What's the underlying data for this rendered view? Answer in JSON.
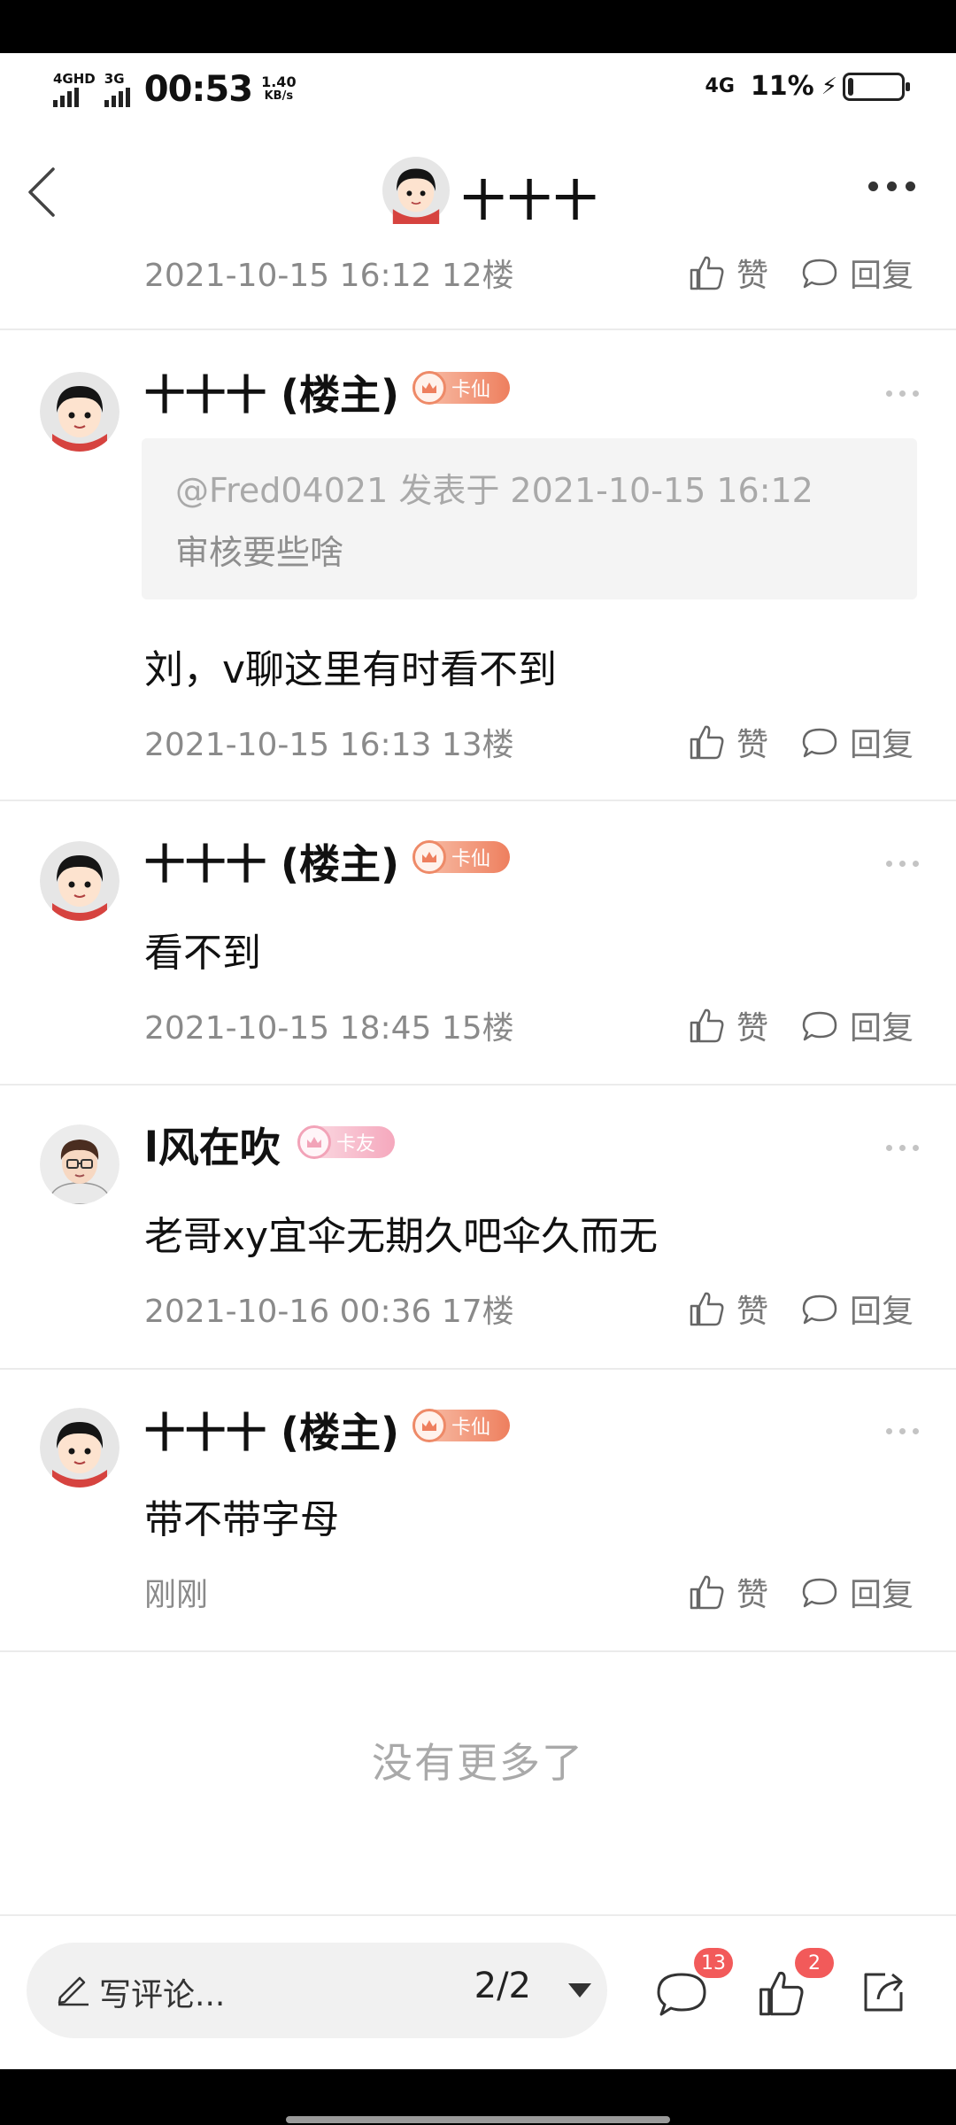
{
  "status": {
    "sig1_label": "4GHD",
    "sig2_label": "3G",
    "time": "00:53",
    "speed_value": "1.40",
    "speed_unit": "KB/s",
    "network": "4G",
    "battery_pct": "11%",
    "battery_level": 0.11
  },
  "nav": {
    "title": "十十十",
    "avatar": "girl-avatar-icon"
  },
  "top_meta": {
    "date": "2021-10-15 16:12",
    "floor": "12楼"
  },
  "actions": {
    "like": "赞",
    "reply": "回复"
  },
  "posts": [
    {
      "user": "十十十 (楼主)",
      "badge": "卡仙",
      "quote_head": "@Fred04021 发表于 2021-10-15 16:12",
      "quote_body": "审核要些啥",
      "content": "刘，v聊这里有时看不到",
      "date": "2021-10-15 16:13",
      "floor": "13楼"
    },
    {
      "user": "十十十 (楼主)",
      "badge": "卡仙",
      "content": "看不到",
      "date": "2021-10-15 18:45",
      "floor": "15楼"
    },
    {
      "user": "l风在吹",
      "badge": "卡友",
      "content": "老哥xy宜伞无期久吧伞久而无",
      "date": "2021-10-16 00:36",
      "floor": "17楼"
    },
    {
      "user": "十十十 (楼主)",
      "badge": "卡仙",
      "content": "带不带字母",
      "date": "刚刚",
      "floor": ""
    }
  ],
  "footer_note": "没有更多了",
  "bottom": {
    "placeholder": "写评论...",
    "page": "2/2",
    "comment_count": "13",
    "like_count": "2"
  }
}
